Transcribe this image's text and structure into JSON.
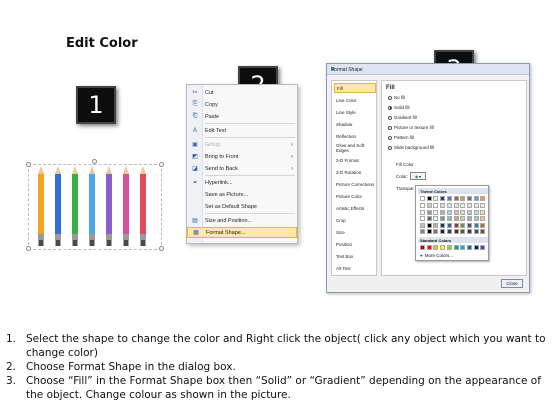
{
  "title": "Edit Color",
  "steps": [
    {
      "num": "1.",
      "text": "Select the shape to change the color and Right click the object( click any object which you want to change color)"
    },
    {
      "num": "2.",
      "text": "Choose Format Shape in the dialog box."
    },
    {
      "num": "3.",
      "text": "Choose “Fill” in the Format Shape box then “Solid” or “Gradient” depending on the appearance of the object. Change colour as shown in the picture."
    }
  ],
  "badges": {
    "one": "1",
    "two": "2",
    "three": "3"
  },
  "pencil_colors": [
    "#f2a41c",
    "#2f6fd6",
    "#3cb043",
    "#4aa8e8",
    "#8b5fc9",
    "#d94f9a",
    "#e04a5a"
  ],
  "context_menu": {
    "items": [
      {
        "icon": "cut-icon",
        "glyph": "✂",
        "label": "Cut"
      },
      {
        "icon": "copy-icon",
        "glyph": "⎘",
        "label": "Copy"
      },
      {
        "icon": "paste-icon",
        "glyph": "⎗",
        "label": "Paste"
      },
      {
        "icon": "edit-text-icon",
        "glyph": "A",
        "label": "Edit Text"
      },
      {
        "icon": "group-icon",
        "glyph": "▣",
        "label": "Group"
      },
      {
        "icon": "bring-front-icon",
        "glyph": "◩",
        "label": "Bring to Front"
      },
      {
        "icon": "send-back-icon",
        "glyph": "◪",
        "label": "Send to Back"
      },
      {
        "icon": "hyperlink-icon",
        "glyph": "⚭",
        "label": "Hyperlink..."
      },
      {
        "icon": "",
        "glyph": "",
        "label": "Save as Picture..."
      },
      {
        "icon": "",
        "glyph": "",
        "label": "Set as Default Shape"
      },
      {
        "icon": "size-position-icon",
        "glyph": "▤",
        "label": "Size and Position..."
      },
      {
        "icon": "format-shape-icon",
        "glyph": "▦",
        "label": "Format Shape..."
      }
    ]
  },
  "dialog": {
    "title": "Format Shape",
    "nav": [
      "Fill",
      "Line Color",
      "Line Style",
      "Shadow",
      "Reflection",
      "Glow and Soft Edges",
      "3-D Format",
      "3-D Rotation",
      "Picture Corrections",
      "Picture Color",
      "Artistic Effects",
      "Crop",
      "Size",
      "Position",
      "Text Box",
      "Alt Text"
    ],
    "fill_heading": "Fill",
    "options": [
      "No fill",
      "Solid fill",
      "Gradient fill",
      "Picture or texture fill",
      "Pattern fill",
      "Slide background fill"
    ],
    "fill_color_label": "Fill Color",
    "color_label": "Color:",
    "transparency_label": "Transpar",
    "theme_colors_label": "Theme Colors",
    "standard_colors_label": "Standard Colors",
    "more_colors_label": "More Colors...",
    "close_label": "Close",
    "theme_top": [
      "#ffffff",
      "#000000",
      "#eeece1",
      "#1f497d",
      "#4f81bd",
      "#c0504d",
      "#9bbb59",
      "#8064a2",
      "#4bacc6",
      "#f79646"
    ],
    "standard": [
      "#c00000",
      "#ff0000",
      "#ffc000",
      "#ffff00",
      "#92d050",
      "#00b050",
      "#00b0f0",
      "#0070c0",
      "#002060",
      "#7030a0"
    ]
  }
}
